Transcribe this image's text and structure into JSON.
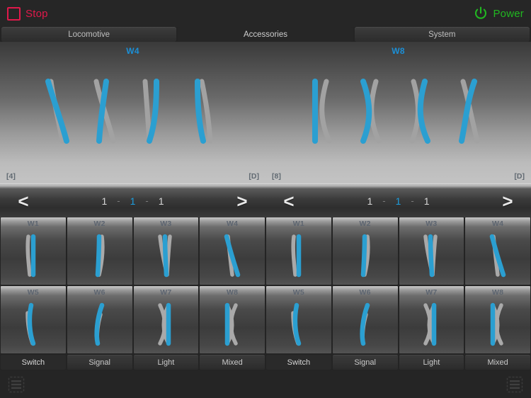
{
  "topbar": {
    "stop": {
      "label": "Stop",
      "icon": "stop-square-icon",
      "color": "#e0194b"
    },
    "power": {
      "label": "Power",
      "icon": "power-icon",
      "color": "#21b821"
    }
  },
  "tabs": [
    {
      "label": "Locomotive",
      "active": false
    },
    {
      "label": "Accessories",
      "active": true
    },
    {
      "label": "System",
      "active": false
    }
  ],
  "display": {
    "left": {
      "title": "W4",
      "footer_left": "[4]",
      "footer_right": "[D]",
      "symbols": [
        "switch-left-diverging",
        "switch-right-diverging",
        "switch-curve-right",
        "switch-curve-left"
      ]
    },
    "right": {
      "title": "W8",
      "footer_left": "[8]",
      "footer_right": "[D]",
      "symbols": [
        "crossing-straight-left",
        "crossing-x",
        "crossing-curve-right",
        "crossing-curve-left"
      ]
    }
  },
  "navbars": [
    {
      "prev": "<",
      "next": ">",
      "numbers": [
        {
          "value": "1",
          "selected": false
        },
        {
          "value": "1",
          "selected": true
        },
        {
          "value": "1",
          "selected": false
        }
      ],
      "separator": "-"
    },
    {
      "prev": "<",
      "next": ">",
      "numbers": [
        {
          "value": "1",
          "selected": false
        },
        {
          "value": "1",
          "selected": true
        },
        {
          "value": "1",
          "selected": false
        }
      ],
      "separator": "-"
    }
  ],
  "grids": [
    {
      "cells": [
        {
          "label": "W1",
          "symbol": "sw1"
        },
        {
          "label": "W2",
          "symbol": "sw2"
        },
        {
          "label": "W3",
          "symbol": "sw3"
        },
        {
          "label": "W4",
          "symbol": "sw4"
        },
        {
          "label": "W5",
          "symbol": "sw5"
        },
        {
          "label": "W6",
          "symbol": "sw6"
        },
        {
          "label": "W7",
          "symbol": "sw7"
        },
        {
          "label": "W8",
          "symbol": "sw8"
        }
      ],
      "categories": [
        {
          "label": "Switch",
          "active": true
        },
        {
          "label": "Signal",
          "active": false
        },
        {
          "label": "Light",
          "active": false
        },
        {
          "label": "Mixed",
          "active": false
        }
      ]
    },
    {
      "cells": [
        {
          "label": "W1",
          "symbol": "sw1"
        },
        {
          "label": "W2",
          "symbol": "sw2"
        },
        {
          "label": "W3",
          "symbol": "sw3"
        },
        {
          "label": "W4",
          "symbol": "sw4"
        },
        {
          "label": "W5",
          "symbol": "sw5"
        },
        {
          "label": "W6",
          "symbol": "sw6"
        },
        {
          "label": "W7",
          "symbol": "sw7"
        },
        {
          "label": "W8",
          "symbol": "sw8"
        }
      ],
      "categories": [
        {
          "label": "Switch",
          "active": true
        },
        {
          "label": "Signal",
          "active": false
        },
        {
          "label": "Light",
          "active": false
        },
        {
          "label": "Mixed",
          "active": false
        }
      ]
    }
  ],
  "bottombar": {
    "left_icon": "list-view-icon",
    "right_icon": "list-view-icon"
  },
  "colors": {
    "accent_blue": "#1c9fe0",
    "track_grey": "#a8a8a8",
    "stop_red": "#e0194b",
    "power_green": "#21b821"
  }
}
